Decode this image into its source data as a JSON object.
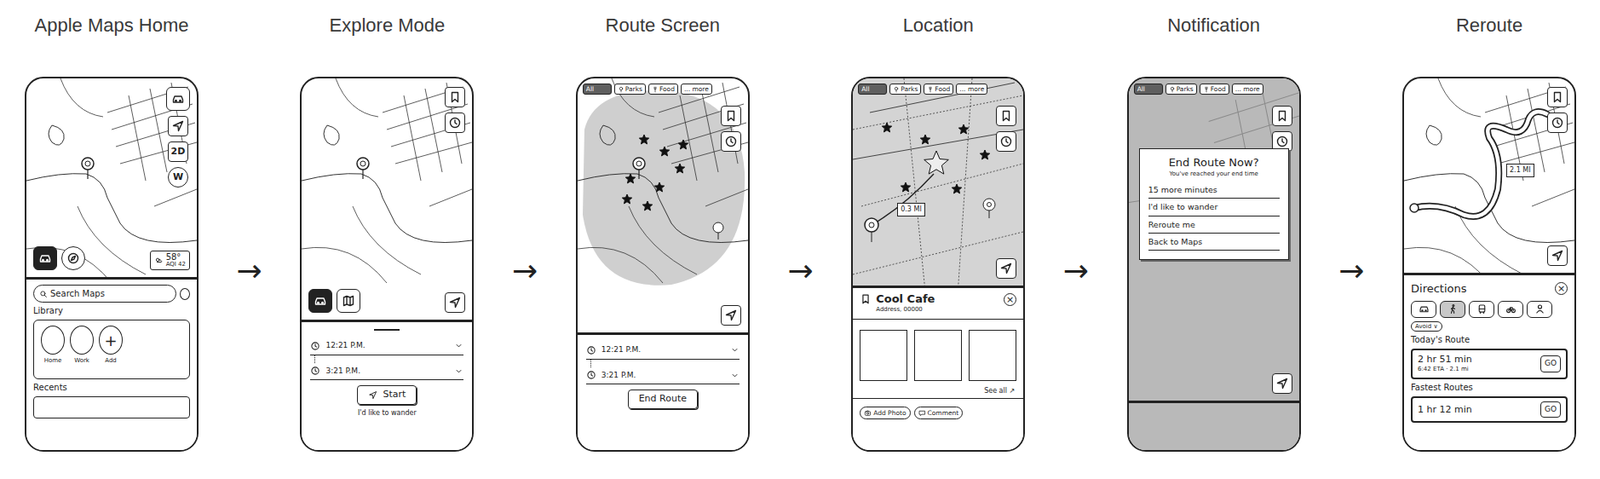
{
  "screens": [
    {
      "kind": "home",
      "title": "Apple Maps Home",
      "map_buttons": [
        "2D",
        "W"
      ],
      "weather": {
        "temp": "58°",
        "aqi": "AQI 42"
      },
      "search_placeholder": "Search Maps",
      "library": {
        "title": "Library",
        "items": [
          {
            "label": "Home"
          },
          {
            "label": "Work"
          },
          {
            "label": "Add",
            "glyph": "+"
          }
        ]
      },
      "recents": "Recents"
    },
    {
      "kind": "explore",
      "title": "Explore Mode",
      "times": [
        "12:21 P.M.",
        "3:21 P.M."
      ],
      "start": "Start",
      "wander": "I'd like to wander"
    },
    {
      "kind": "route",
      "title": "Route Screen",
      "filters": [
        {
          "label": "All",
          "selected": true
        },
        {
          "label": "Parks",
          "selected": false
        },
        {
          "label": "Food",
          "selected": false
        },
        {
          "label": "... more",
          "selected": false
        }
      ],
      "times": [
        "12:21 P.M.",
        "3:21 P.M."
      ],
      "end": "End Route"
    },
    {
      "kind": "location",
      "title": "Location",
      "filters": [
        {
          "label": "All",
          "selected": true
        },
        {
          "label": "Parks",
          "selected": false
        },
        {
          "label": "Food",
          "selected": false
        },
        {
          "label": "... more",
          "selected": false
        }
      ],
      "distance": "0.3 MI",
      "place": {
        "name": "Cool Cafe",
        "address": "Address, 00000",
        "close": "×",
        "see_all": "See all ↗"
      },
      "actions": [
        "Add Photo",
        "Comment"
      ]
    },
    {
      "kind": "notification",
      "title": "Notification",
      "filters": [
        {
          "label": "All",
          "selected": true
        },
        {
          "label": "Parks",
          "selected": false
        },
        {
          "label": "Food",
          "selected": false
        },
        {
          "label": "... more",
          "selected": false
        }
      ],
      "dialog": {
        "title": "End Route Now?",
        "subtitle": "You've reached your end time",
        "options": [
          "15 more minutes",
          "I'd like to wander",
          "Reroute me",
          "Back to Maps"
        ]
      }
    },
    {
      "kind": "reroute",
      "title": "Reroute",
      "distance": "2.1 MI",
      "panel": {
        "title": "Directions",
        "close": "×",
        "modes": [
          {
            "selected": false
          },
          {
            "selected": true
          },
          {
            "selected": false
          },
          {
            "selected": false
          },
          {
            "selected": false
          }
        ],
        "avoid": "Avoid ∨",
        "sections": [
          {
            "title": "Today's Route",
            "routes": [
              {
                "time": "2 hr 51 min",
                "detail": "6:42 ETA · 2.1 mi",
                "go": "GO"
              }
            ]
          },
          {
            "title": "Fastest Routes",
            "routes": [
              {
                "time": "1 hr 12 min",
                "go": "GO"
              }
            ]
          }
        ]
      }
    }
  ],
  "arrow": "→"
}
